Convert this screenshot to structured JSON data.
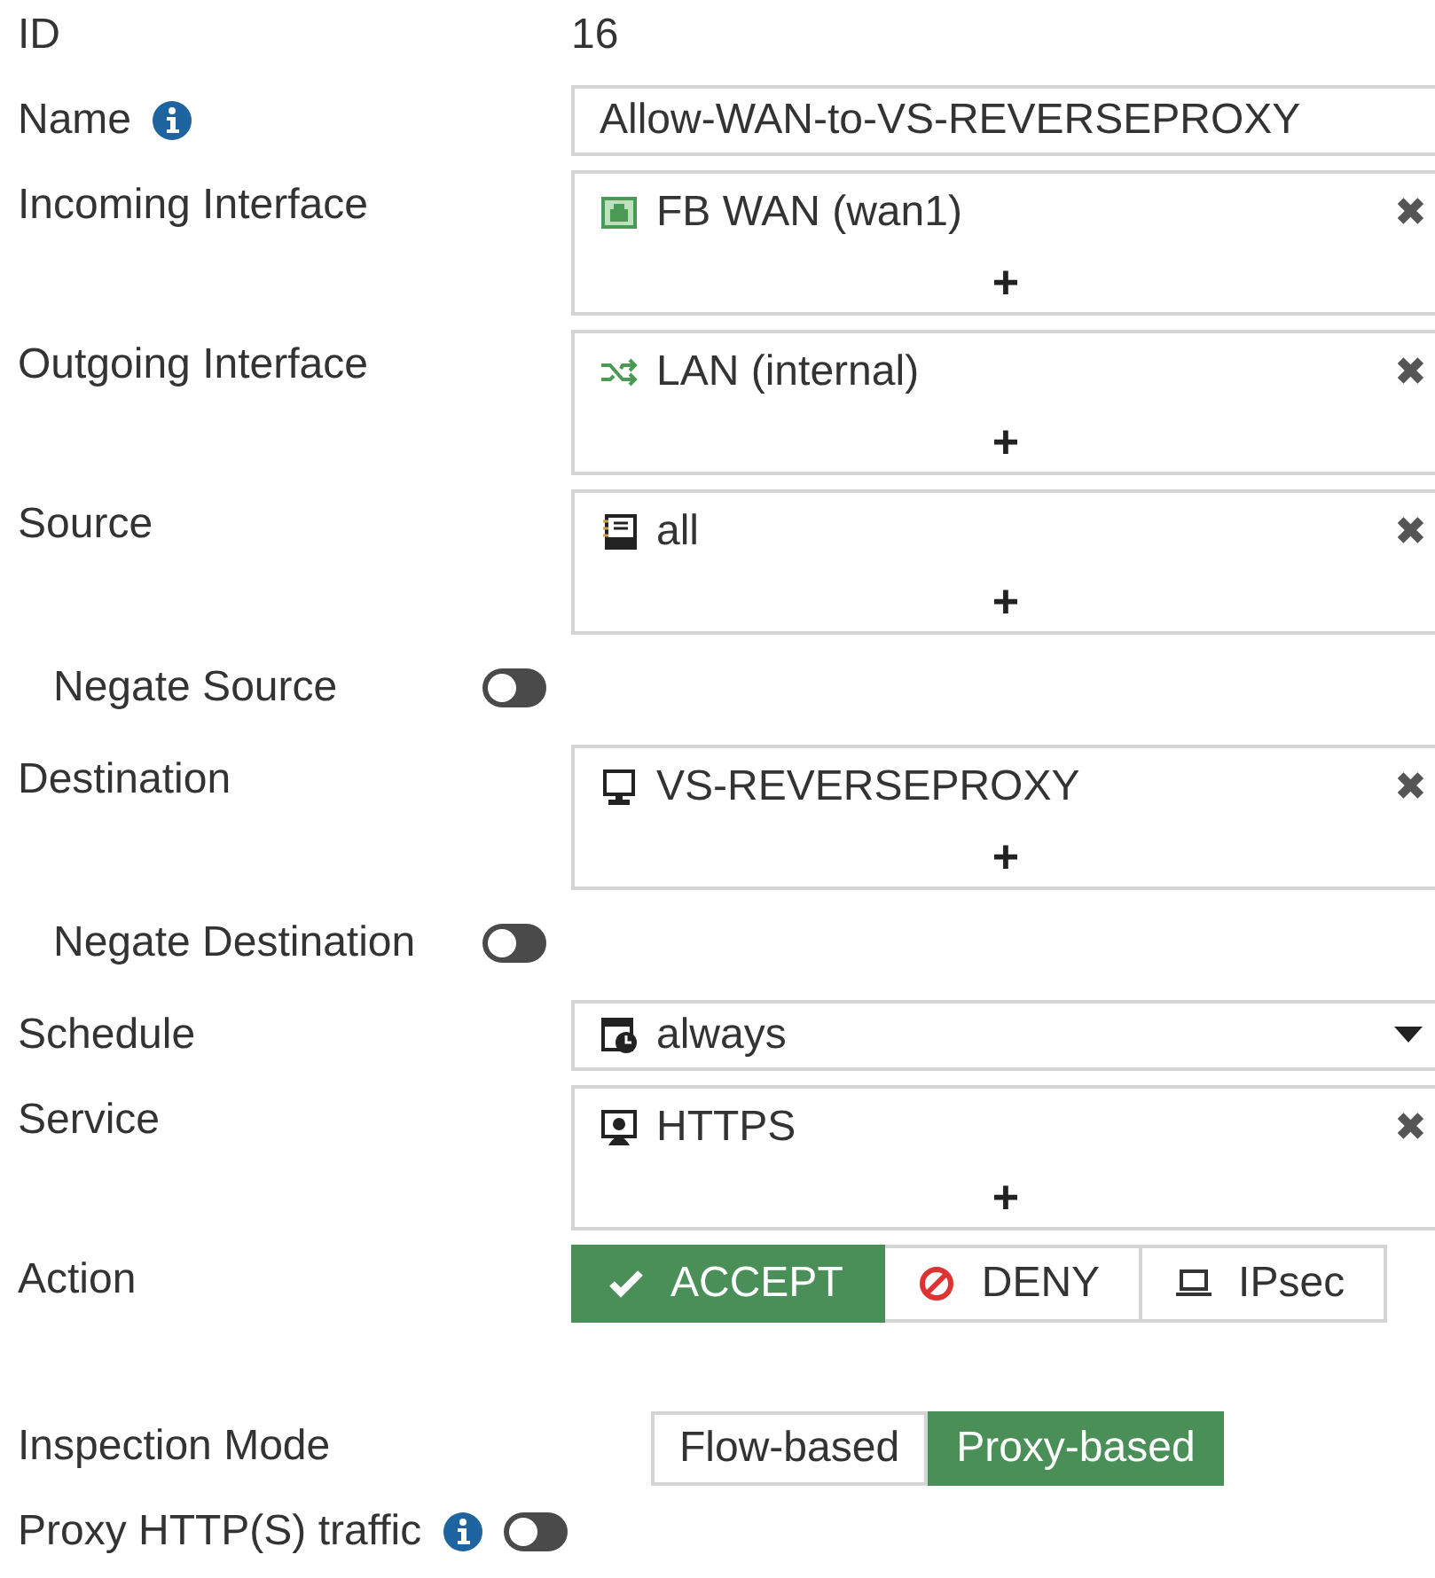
{
  "fields": [
    {
      "kind": "text",
      "label": "ID",
      "value": "16"
    },
    {
      "kind": "input",
      "label": "Name",
      "info": true,
      "value": "Allow-WAN-to-VS-REVERSEPROXY"
    },
    {
      "kind": "list",
      "label": "Incoming Interface",
      "add": "+",
      "items": [
        {
          "kind": "port",
          "text": "FB WAN (wan1)",
          "remove": "✖"
        }
      ]
    },
    {
      "kind": "list",
      "label": "Outgoing Interface",
      "add": "+",
      "items": [
        {
          "kind": "zone",
          "text": "LAN (internal)",
          "remove": "✖"
        }
      ]
    },
    {
      "kind": "list",
      "label": "Source",
      "add": "+",
      "items": [
        {
          "kind": "address",
          "text": "all",
          "remove": "✖"
        }
      ],
      "children": [
        {
          "kind": "toggle",
          "label": "Negate Source",
          "on": false
        }
      ]
    },
    {
      "kind": "list",
      "label": "Destination",
      "add": "+",
      "items": [
        {
          "kind": "vip",
          "text": "VS-REVERSEPROXY",
          "remove": "✖"
        }
      ],
      "children": [
        {
          "kind": "toggle",
          "label": "Negate Destination",
          "on": false
        }
      ]
    },
    {
      "kind": "select",
      "label": "Schedule",
      "item": {
        "kind": "schedule",
        "text": "always"
      }
    },
    {
      "kind": "list",
      "label": "Service",
      "add": "+",
      "items": [
        {
          "kind": "service",
          "text": "HTTPS",
          "remove": "✖"
        }
      ]
    },
    {
      "kind": "buttons",
      "label": "Action",
      "options": [
        {
          "kind": "accept",
          "label": "ACCEPT",
          "selected": true
        },
        {
          "kind": "deny",
          "label": "DENY",
          "selected": false
        },
        {
          "kind": "ipsec",
          "label": "IPsec",
          "selected": false
        }
      ]
    },
    {
      "kind": "segmented",
      "label": "Inspection Mode",
      "options": [
        {
          "label": "Flow-based",
          "selected": false
        },
        {
          "label": "Proxy-based",
          "selected": true
        }
      ]
    },
    {
      "kind": "toggle",
      "label": "Proxy HTTP(S) traffic",
      "info": true,
      "on": false
    }
  ]
}
